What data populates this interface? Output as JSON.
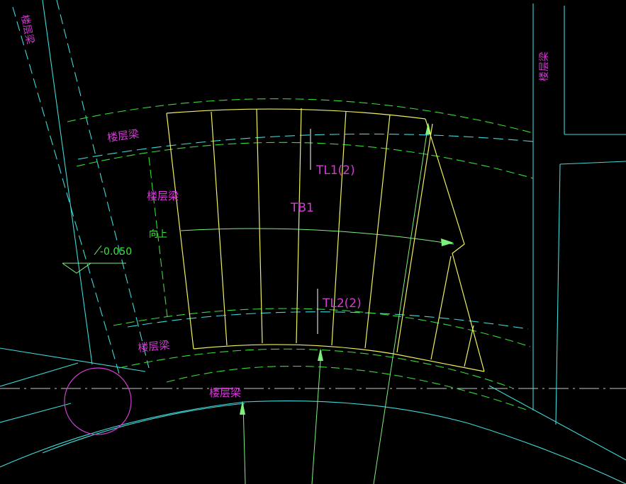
{
  "colors": {
    "background": "#000000",
    "cyan": "#3fd9d9",
    "green": "#33dd33",
    "yellow": "#f0f060",
    "magenta": "#d23cd2",
    "grid_white": "#c8c8c8"
  },
  "labels": {
    "beam_vertical_left": "楼层梁",
    "beam_vertical_right": "楼层梁",
    "beam_top_left": "楼层梁",
    "beam_mid_left": "楼层梁",
    "beam_bottom_left": "楼层梁",
    "beam_bottom_center": "楼层梁",
    "stair_slab": "TB1",
    "stair_beam_upper": "TL1(2)",
    "stair_beam_lower": "TL2(2)",
    "direction_up": "向上",
    "elevation": "-0.050"
  }
}
